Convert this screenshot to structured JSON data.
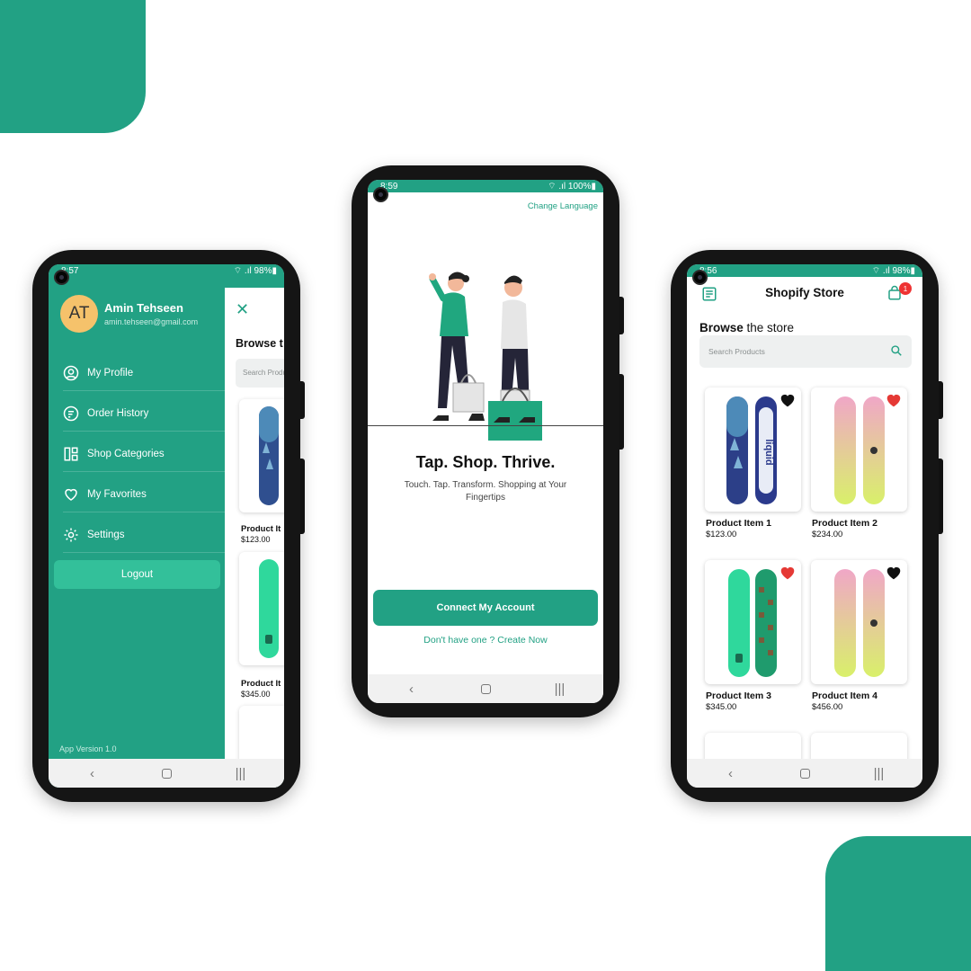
{
  "phone_left": {
    "status": {
      "time": "8:57",
      "right": "⌔ .ıl 98%▮"
    },
    "user": {
      "initials": "AT",
      "name": "Amin Tehseen",
      "email": "amin.tehseen@gmail.com"
    },
    "menu": [
      {
        "label": "My Profile",
        "icon": "person-circle-icon"
      },
      {
        "label": "Order History",
        "icon": "receipt-icon"
      },
      {
        "label": "Shop Categories",
        "icon": "dashboard-icon"
      },
      {
        "label": "My Favorites",
        "icon": "heart-outline-icon"
      },
      {
        "label": "Settings",
        "icon": "gear-icon"
      }
    ],
    "logout_label": "Logout",
    "app_version": "App Version 1.0",
    "behind": {
      "browse_label": "Browse t",
      "search_placeholder": "Search Produ",
      "products": [
        {
          "name": "Product It",
          "price": "$123.00"
        },
        {
          "name": "Product It",
          "price": "$345.00"
        }
      ]
    }
  },
  "phone_center": {
    "status": {
      "time": "8:59",
      "right": "⌔ .ıl 100%▮"
    },
    "change_language": "Change Language",
    "tagline": "Tap. Shop. Thrive.",
    "subtagline": "Touch. Tap. Transform. Shopping at Your Fingertips",
    "connect_button": "Connect My Account",
    "create_link": "Don't have one ? Create Now"
  },
  "phone_right": {
    "status": {
      "time": "8:56",
      "right": "⌔ .ıl 98%▮"
    },
    "title": "Shopify Store",
    "cart_count": "1",
    "browse_bold": "Browse",
    "browse_rest": " the store",
    "search_placeholder": "Search Products",
    "products": [
      {
        "name": "Product Item 1",
        "price": "$123.00",
        "favorite": false
      },
      {
        "name": "Product Item 2",
        "price": "$234.00",
        "favorite": true
      },
      {
        "name": "Product Item 3",
        "price": "$345.00",
        "favorite": true
      },
      {
        "name": "Product Item 4",
        "price": "$456.00",
        "favorite": false
      }
    ]
  },
  "navbar": {
    "back": "‹",
    "recents": "|||"
  },
  "colors": {
    "brand": "#22a184",
    "favorite": "#e53935",
    "not_favorite": "#111111"
  }
}
